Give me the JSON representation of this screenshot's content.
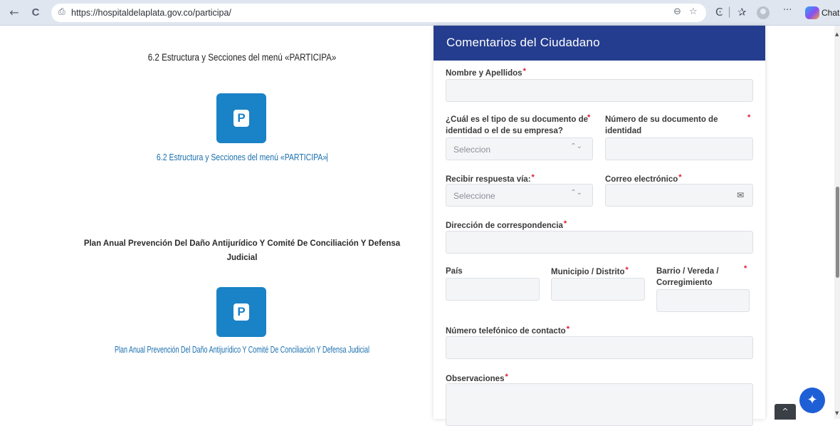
{
  "browser": {
    "url": "https://hospitaldelaplata.gov.co/participa/",
    "chat_label": "Chat",
    "back_glyph": "←",
    "reload_glyph": "C",
    "lock_glyph": "⎙",
    "zoom_glyph": "⊖",
    "star_glyph": "☆",
    "ext_glyph": "Ͼ",
    "fav_glyph": "✰",
    "more_glyph": "···",
    "icons": [
      "back-arrow-icon",
      "reload-icon",
      "lock-icon",
      "zoom-icon",
      "favorite-star-icon",
      "extensions-icon",
      "favorites-icon",
      "profile-icon",
      "more-icon",
      "copilot-icon"
    ]
  },
  "left": {
    "heading_62": "6.2 Estructura y Secciones del menú «PARTICIPA»",
    "badge_letter": "P",
    "link_62": "6.2 Estructura y Secciones del menú «PARTICIPA»",
    "heading_plan": "Plan Anual Prevención Del Daño Antijurídico Y Comité De Conciliación Y Defensa Judicial",
    "link_plan": "Plan Anual Prevención Del Daño Antijurídico Y Comité De Conciliación Y Defensa Judicial",
    "badge_color": "#1a82c6"
  },
  "form": {
    "title": "Comentarios del Ciudadano",
    "header_color": "#253d8f",
    "required_mark": "*",
    "labels": {
      "nombre": "Nombre y Apellidos",
      "tipo_doc": "¿Cuál es el tipo de su documento de identidad o el de su empresa?",
      "num_doc": "Número de su documento de identidad",
      "respuesta": "Recibir respuesta vía:",
      "correo": "Correo electrónico",
      "direccion": "Dirección de correspondencia",
      "pais": "País",
      "municipio": "Municipio / Distrito",
      "barrio": "Barrio / Vereda / Corregimiento",
      "telefono": "Número telefónico de contacto",
      "observaciones": "Observaciones"
    },
    "tipo_doc_value": "Seleccion",
    "respuesta_value": "Seleccione",
    "select_arrows": "⌃⌄",
    "envelope_glyph": "✉"
  },
  "widgets": {
    "back_to_top_glyph": "^",
    "accessibility_glyph": "✦",
    "scroll_up": "▲",
    "scroll_down": "▼"
  }
}
